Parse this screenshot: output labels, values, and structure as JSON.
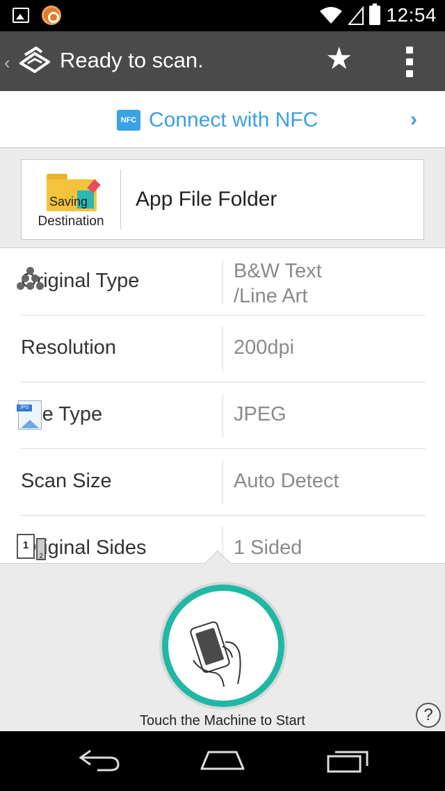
{
  "status_bar": {
    "time": "12:54",
    "icons": [
      "image-notification-icon",
      "app-notification-icon",
      "wifi-icon",
      "signal-icon",
      "battery-icon"
    ]
  },
  "action_bar": {
    "title": "Ready to scan.",
    "icons": [
      "back-chevron-icon",
      "scanner-icon",
      "star-icon",
      "overflow-menu-icon"
    ]
  },
  "nfc": {
    "badge": "NFC",
    "label": "Connect with NFC",
    "chevron": "›",
    "accent_color": "#3a9fe0"
  },
  "destination": {
    "icon_label_line1": "Saving",
    "icon_label_line2": "Destination",
    "title": "App File Folder"
  },
  "settings": [
    {
      "label": "Original Type",
      "value_line1": "B&W Text",
      "value_line2": "/Line Art",
      "icon": "color-dots-icon"
    },
    {
      "label": "Resolution",
      "value": "200dpi"
    },
    {
      "label": "File Type",
      "value": "JPEG",
      "icon": "jpeg-file-icon",
      "icon_text": "JPG"
    },
    {
      "label": "Scan Size",
      "value": "Auto Detect"
    },
    {
      "label": "Original Sides",
      "value": "1 Sided",
      "icon": "one-sided-icon",
      "icon_text_front": "1",
      "icon_text_back": "2"
    }
  ],
  "bottom": {
    "touch_label": "Touch the Machine to Start",
    "help": "?",
    "ring_color": "#20b8a5"
  },
  "nav_bar": {
    "icons": [
      "back-icon",
      "home-icon",
      "recents-icon"
    ]
  }
}
